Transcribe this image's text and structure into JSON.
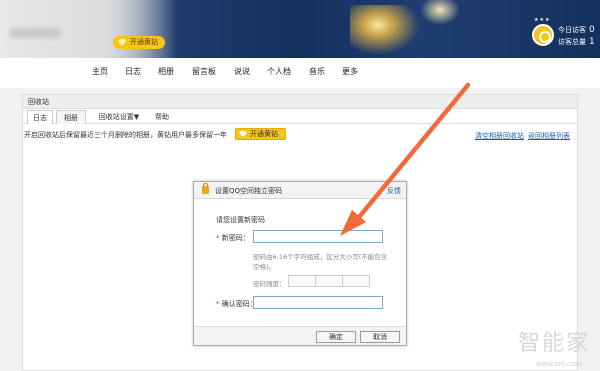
{
  "header": {
    "vip_label": "开通黄钻",
    "visitor_today_label": "今日访客",
    "visitor_today_value": "0",
    "visitor_total_label": "访客总量",
    "visitor_total_value": "1"
  },
  "nav": {
    "items": [
      "主页",
      "日志",
      "相册",
      "留言板",
      "说说",
      "个人档",
      "音乐",
      "更多"
    ]
  },
  "panel": {
    "title": "回收站",
    "tabs": [
      "日志",
      "相册",
      "回收站设置▼",
      "帮助"
    ],
    "info_text": "开启回收站后保留最近三个月删除的相册，黄钻用户最多保留一年",
    "vip_btn_label": "开通黄钻",
    "links": [
      "清空相册回收站",
      "返回相册列表"
    ]
  },
  "dialog": {
    "title": "设置QQ空间独立密码",
    "feedback": "反馈",
    "instruction": "请您设置新密码",
    "new_pw_label": "新密码：",
    "hint": "密码由6-16个字符组成，区分大小写(不能包含空格)。",
    "strength_label": "密码强度：",
    "confirm_pw_label": "确认密码：",
    "ok_label": "确定",
    "cancel_label": "取消"
  },
  "watermark": {
    "text": "智能家",
    "url": "www.znj.com"
  },
  "colors": {
    "accent_yellow": "#f5c517",
    "link_blue": "#1a5fa8",
    "arrow_orange": "#f26a3c",
    "banner_blue": "#14305d"
  }
}
